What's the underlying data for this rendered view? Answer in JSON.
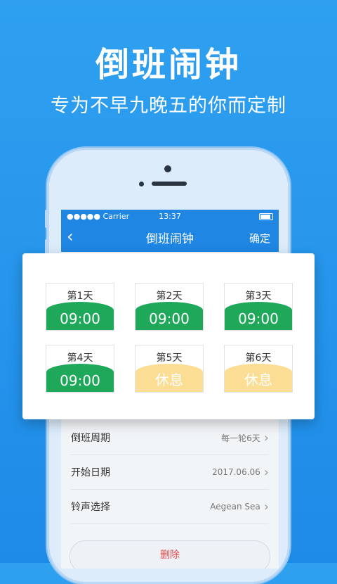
{
  "hero": {
    "title": "倒班闹钟",
    "subtitle": "专为不早九晚五的你而定制"
  },
  "statusbar": {
    "carrier": "●●●●● Carrier",
    "time": "13:37"
  },
  "navbar": {
    "back_icon": "‹",
    "title": "倒班闹钟",
    "confirm": "确定"
  },
  "days": [
    {
      "label": "第1天",
      "value": "09:00",
      "type": "work"
    },
    {
      "label": "第2天",
      "value": "09:00",
      "type": "work"
    },
    {
      "label": "第3天",
      "value": "09:00",
      "type": "work"
    },
    {
      "label": "第4天",
      "value": "09:00",
      "type": "work"
    },
    {
      "label": "第5天",
      "value": "休息",
      "type": "rest"
    },
    {
      "label": "第6天",
      "value": "休息",
      "type": "rest"
    }
  ],
  "settings": {
    "period": {
      "label": "倒班周期",
      "value": "每一轮6天"
    },
    "start_date": {
      "label": "开始日期",
      "value": "2017.06.06"
    },
    "ringtone": {
      "label": "铃声选择",
      "value": "Aegean Sea"
    }
  },
  "delete_label": "删除",
  "colors": {
    "background": "#2fa0f0",
    "nav_blue": "#1f86e3",
    "work_green": "#1fa85a",
    "rest_yellow": "#fbdd93",
    "delete_red": "#e24a4a"
  }
}
